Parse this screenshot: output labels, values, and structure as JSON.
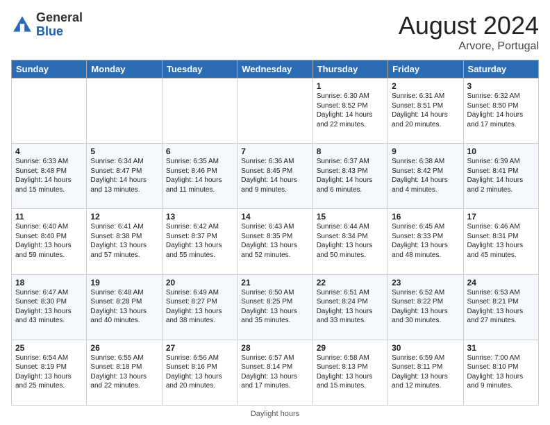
{
  "header": {
    "logo_general": "General",
    "logo_blue": "Blue",
    "month_year": "August 2024",
    "location": "Arvore, Portugal"
  },
  "note": "Daylight hours",
  "days_of_week": [
    "Sunday",
    "Monday",
    "Tuesday",
    "Wednesday",
    "Thursday",
    "Friday",
    "Saturday"
  ],
  "weeks": [
    [
      {
        "num": "",
        "info": ""
      },
      {
        "num": "",
        "info": ""
      },
      {
        "num": "",
        "info": ""
      },
      {
        "num": "",
        "info": ""
      },
      {
        "num": "1",
        "info": "Sunrise: 6:30 AM\nSunset: 8:52 PM\nDaylight: 14 hours\nand 22 minutes."
      },
      {
        "num": "2",
        "info": "Sunrise: 6:31 AM\nSunset: 8:51 PM\nDaylight: 14 hours\nand 20 minutes."
      },
      {
        "num": "3",
        "info": "Sunrise: 6:32 AM\nSunset: 8:50 PM\nDaylight: 14 hours\nand 17 minutes."
      }
    ],
    [
      {
        "num": "4",
        "info": "Sunrise: 6:33 AM\nSunset: 8:48 PM\nDaylight: 14 hours\nand 15 minutes."
      },
      {
        "num": "5",
        "info": "Sunrise: 6:34 AM\nSunset: 8:47 PM\nDaylight: 14 hours\nand 13 minutes."
      },
      {
        "num": "6",
        "info": "Sunrise: 6:35 AM\nSunset: 8:46 PM\nDaylight: 14 hours\nand 11 minutes."
      },
      {
        "num": "7",
        "info": "Sunrise: 6:36 AM\nSunset: 8:45 PM\nDaylight: 14 hours\nand 9 minutes."
      },
      {
        "num": "8",
        "info": "Sunrise: 6:37 AM\nSunset: 8:43 PM\nDaylight: 14 hours\nand 6 minutes."
      },
      {
        "num": "9",
        "info": "Sunrise: 6:38 AM\nSunset: 8:42 PM\nDaylight: 14 hours\nand 4 minutes."
      },
      {
        "num": "10",
        "info": "Sunrise: 6:39 AM\nSunset: 8:41 PM\nDaylight: 14 hours\nand 2 minutes."
      }
    ],
    [
      {
        "num": "11",
        "info": "Sunrise: 6:40 AM\nSunset: 8:40 PM\nDaylight: 13 hours\nand 59 minutes."
      },
      {
        "num": "12",
        "info": "Sunrise: 6:41 AM\nSunset: 8:38 PM\nDaylight: 13 hours\nand 57 minutes."
      },
      {
        "num": "13",
        "info": "Sunrise: 6:42 AM\nSunset: 8:37 PM\nDaylight: 13 hours\nand 55 minutes."
      },
      {
        "num": "14",
        "info": "Sunrise: 6:43 AM\nSunset: 8:35 PM\nDaylight: 13 hours\nand 52 minutes."
      },
      {
        "num": "15",
        "info": "Sunrise: 6:44 AM\nSunset: 8:34 PM\nDaylight: 13 hours\nand 50 minutes."
      },
      {
        "num": "16",
        "info": "Sunrise: 6:45 AM\nSunset: 8:33 PM\nDaylight: 13 hours\nand 48 minutes."
      },
      {
        "num": "17",
        "info": "Sunrise: 6:46 AM\nSunset: 8:31 PM\nDaylight: 13 hours\nand 45 minutes."
      }
    ],
    [
      {
        "num": "18",
        "info": "Sunrise: 6:47 AM\nSunset: 8:30 PM\nDaylight: 13 hours\nand 43 minutes."
      },
      {
        "num": "19",
        "info": "Sunrise: 6:48 AM\nSunset: 8:28 PM\nDaylight: 13 hours\nand 40 minutes."
      },
      {
        "num": "20",
        "info": "Sunrise: 6:49 AM\nSunset: 8:27 PM\nDaylight: 13 hours\nand 38 minutes."
      },
      {
        "num": "21",
        "info": "Sunrise: 6:50 AM\nSunset: 8:25 PM\nDaylight: 13 hours\nand 35 minutes."
      },
      {
        "num": "22",
        "info": "Sunrise: 6:51 AM\nSunset: 8:24 PM\nDaylight: 13 hours\nand 33 minutes."
      },
      {
        "num": "23",
        "info": "Sunrise: 6:52 AM\nSunset: 8:22 PM\nDaylight: 13 hours\nand 30 minutes."
      },
      {
        "num": "24",
        "info": "Sunrise: 6:53 AM\nSunset: 8:21 PM\nDaylight: 13 hours\nand 27 minutes."
      }
    ],
    [
      {
        "num": "25",
        "info": "Sunrise: 6:54 AM\nSunset: 8:19 PM\nDaylight: 13 hours\nand 25 minutes."
      },
      {
        "num": "26",
        "info": "Sunrise: 6:55 AM\nSunset: 8:18 PM\nDaylight: 13 hours\nand 22 minutes."
      },
      {
        "num": "27",
        "info": "Sunrise: 6:56 AM\nSunset: 8:16 PM\nDaylight: 13 hours\nand 20 minutes."
      },
      {
        "num": "28",
        "info": "Sunrise: 6:57 AM\nSunset: 8:14 PM\nDaylight: 13 hours\nand 17 minutes."
      },
      {
        "num": "29",
        "info": "Sunrise: 6:58 AM\nSunset: 8:13 PM\nDaylight: 13 hours\nand 15 minutes."
      },
      {
        "num": "30",
        "info": "Sunrise: 6:59 AM\nSunset: 8:11 PM\nDaylight: 13 hours\nand 12 minutes."
      },
      {
        "num": "31",
        "info": "Sunrise: 7:00 AM\nSunset: 8:10 PM\nDaylight: 13 hours\nand 9 minutes."
      }
    ]
  ]
}
